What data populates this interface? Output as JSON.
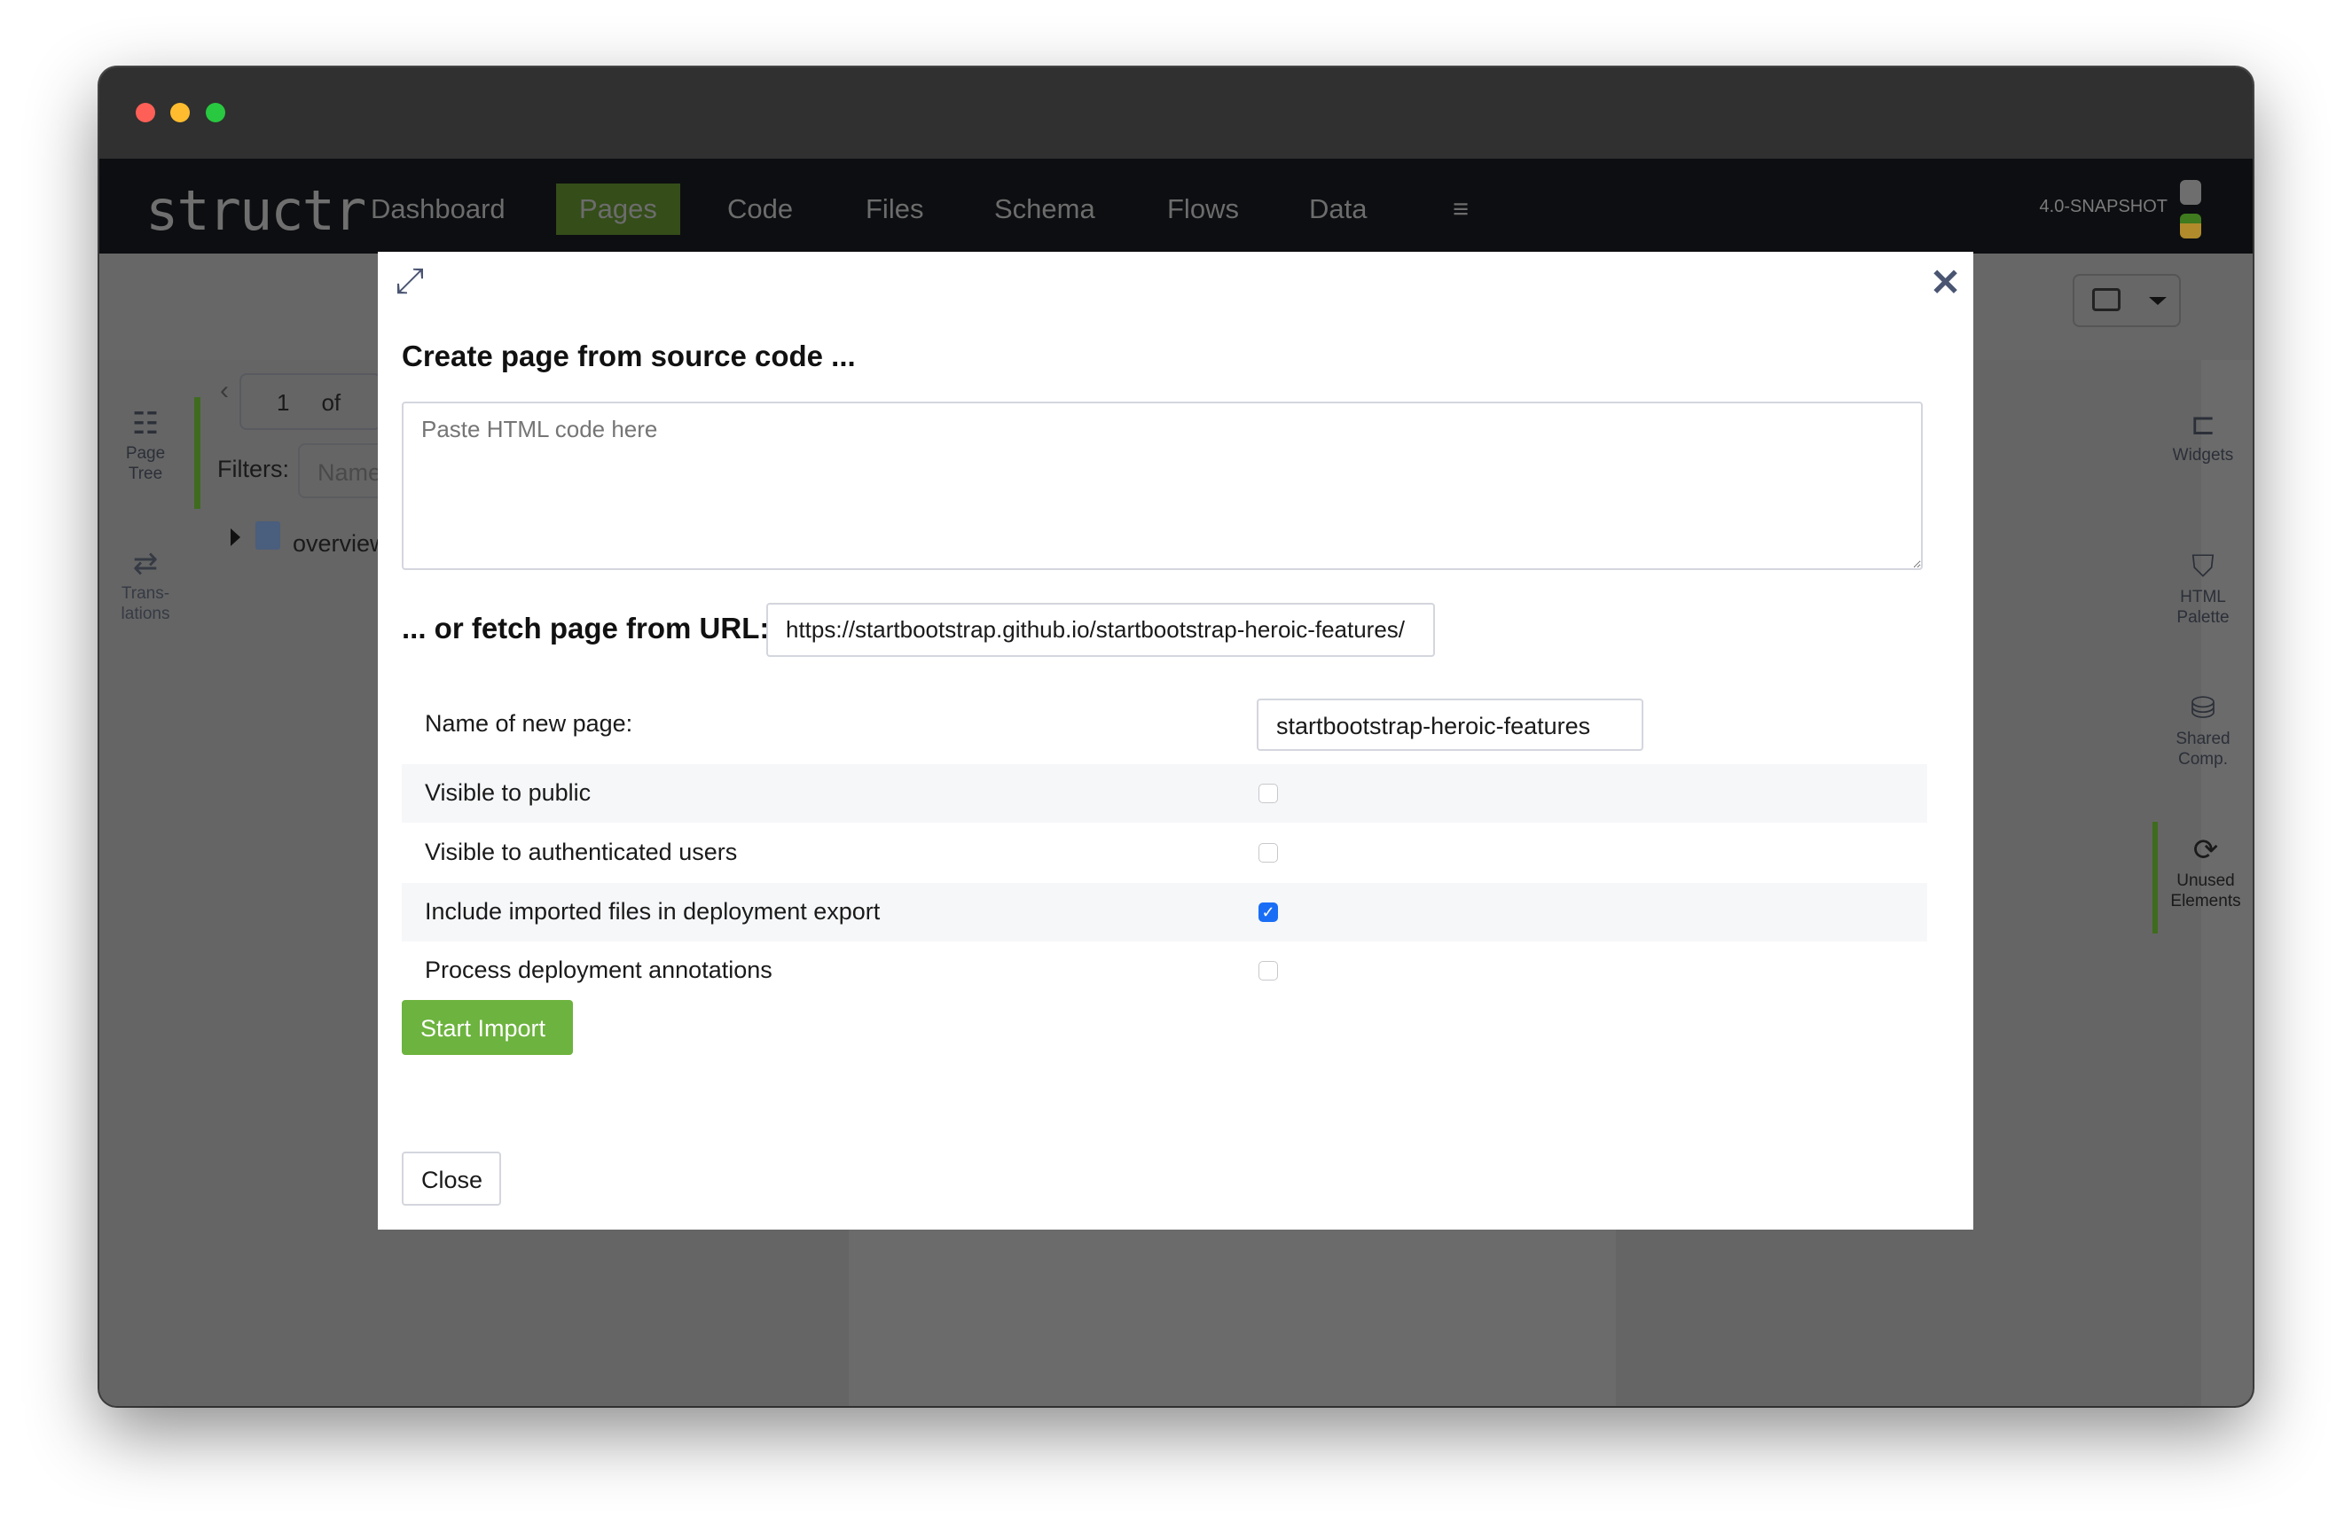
{
  "window": {
    "traffic_lights": [
      "#fe5f57",
      "#febc2e",
      "#28c840"
    ]
  },
  "nav": {
    "logo": "structr",
    "items": [
      {
        "label": "Dashboard"
      },
      {
        "label": "Pages",
        "active": true
      },
      {
        "label": "Code"
      },
      {
        "label": "Files"
      },
      {
        "label": "Schema"
      },
      {
        "label": "Flows"
      },
      {
        "label": "Data"
      }
    ],
    "menu_icon": "hamburger-icon",
    "version": "4.0-SNAPSHOT"
  },
  "left_sidebar": {
    "items": [
      {
        "label": "Page Tree",
        "l1": "Page",
        "l2": "Tree",
        "icon": "page-tree-icon",
        "active": true
      },
      {
        "label": "Translations",
        "l1": "Trans-",
        "l2": "lations",
        "icon": "translate-icon"
      }
    ]
  },
  "page_panel": {
    "page_number": "1",
    "of_label": "of",
    "filters_label": "Filters:",
    "filter_placeholder": "Name",
    "tree_item": "overview"
  },
  "right_sidebar": {
    "items": [
      {
        "l1": "Widgets",
        "l2": "",
        "icon": "widgets-icon"
      },
      {
        "l1": "HTML",
        "l2": "Palette",
        "icon": "html5-icon"
      },
      {
        "l1": "Shared",
        "l2": "Comp.",
        "icon": "shared-components-icon"
      },
      {
        "l1": "Unused",
        "l2": "Elements",
        "icon": "unused-elements-icon",
        "active": true
      }
    ]
  },
  "modal": {
    "title": "Create page from source code ...",
    "source_placeholder": "Paste HTML code here",
    "url_label": "... or fetch page from URL:",
    "url_value": "https://startbootstrap.github.io/startbootstrap-heroic-features/",
    "url_display": "//startbootstrap.github.io/startbootstrap-heroic-features/",
    "name_label": "Name of new page:",
    "name_value": "startbootstrap-heroic-features",
    "options": [
      {
        "label": "Visible to public",
        "checked": false
      },
      {
        "label": "Visible to authenticated users",
        "checked": false
      },
      {
        "label": "Include imported files in deployment export",
        "checked": true
      },
      {
        "label": "Process deployment annotations",
        "checked": false
      }
    ],
    "start_button": "Start Import",
    "close_button": "Close",
    "accent": "#6db33f"
  }
}
